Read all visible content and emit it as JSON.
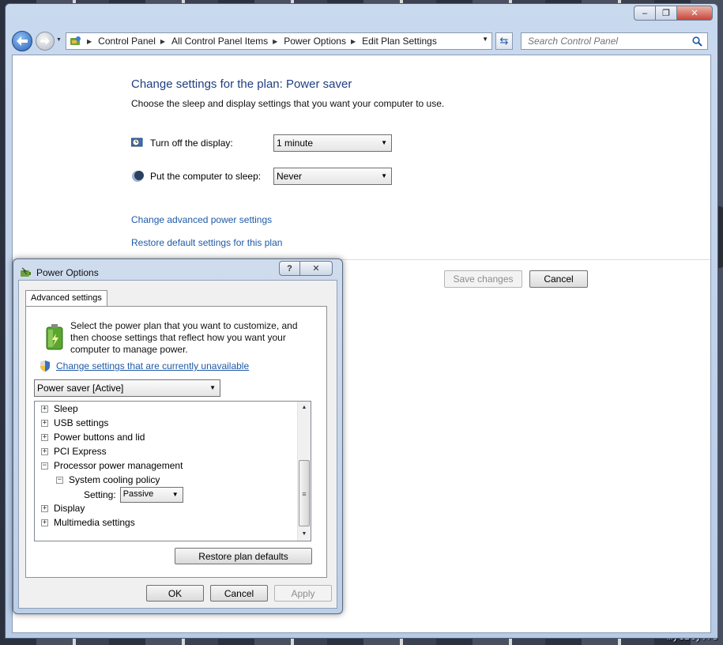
{
  "window": {
    "address_crumbs": [
      "Control Panel",
      "All Control Panel Items",
      "Power Options",
      "Edit Plan Settings"
    ],
    "search_placeholder": "Search Control Panel"
  },
  "plan_settings": {
    "title": "Change settings for the plan: Power saver",
    "subtitle": "Choose the sleep and display settings that you want your computer to use.",
    "display_label": "Turn off the display:",
    "display_value": "1 minute",
    "sleep_label": "Put the computer to sleep:",
    "sleep_value": "Never",
    "advanced_link": "Change advanced power settings",
    "restore_link": "Restore default settings for this plan",
    "save_button": "Save changes",
    "cancel_button": "Cancel"
  },
  "dialog": {
    "title": "Power Options",
    "help_label": "?",
    "tab_label": "Advanced settings",
    "intro_text": "Select the power plan that you want to customize, and then choose settings that reflect how you want your computer to manage power.",
    "unavailable_link": "Change settings that are currently unavailable",
    "plan_selected": "Power saver [Active]",
    "tree": [
      {
        "label": "Sleep",
        "expander": "+"
      },
      {
        "label": "USB settings",
        "expander": "+"
      },
      {
        "label": "Power buttons and lid",
        "expander": "+"
      },
      {
        "label": "PCI Express",
        "expander": "+"
      },
      {
        "label": "Processor power management",
        "expander": "−"
      },
      {
        "label": "System cooling policy",
        "expander": "−"
      },
      {
        "label": "Display",
        "expander": "+"
      },
      {
        "label": "Multimedia settings",
        "expander": "+"
      }
    ],
    "setting_label": "Setting:",
    "setting_value": "Passive",
    "restore_defaults_button": "Restore plan defaults",
    "ok_button": "OK",
    "cancel_button": "Cancel",
    "apply_button": "Apply"
  },
  "desktop": {
    "watermark": "mycity.rs"
  },
  "colors": {
    "heading_blue": "#1e3f82",
    "link_blue": "#1f5aa6",
    "disabled_gray": "#8d8d8d"
  }
}
